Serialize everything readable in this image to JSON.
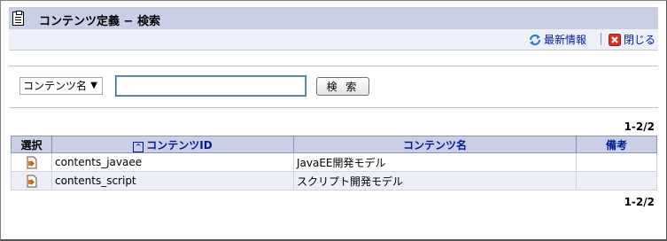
{
  "header": {
    "title": "コンテンツ定義 − 検索"
  },
  "toolbar": {
    "refresh_label": "最新情報",
    "close_label": "閉じる"
  },
  "search": {
    "field_selected": "コンテンツ名",
    "query_value": "",
    "button_label": "検 索"
  },
  "pager": {
    "top": "1-2/2",
    "bottom": "1-2/2"
  },
  "table": {
    "columns": [
      "選択",
      "コンテンツID",
      "コンテンツ名",
      "備考"
    ],
    "rows": [
      {
        "id": "contents_javaee",
        "name": "JavaEE開発モデル",
        "note": ""
      },
      {
        "id": "contents_script",
        "name": "スクリプト開発モデル",
        "note": ""
      }
    ]
  }
}
